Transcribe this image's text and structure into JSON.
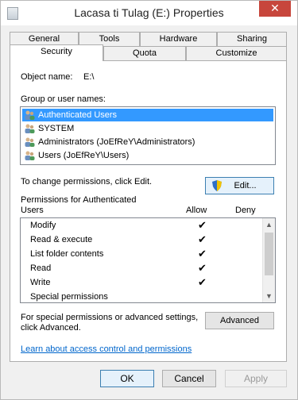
{
  "window": {
    "title": "Lacasa ti Tulag (E:) Properties",
    "close_glyph": "✕"
  },
  "tabs": {
    "row_top": [
      "General",
      "Tools",
      "Hardware",
      "Sharing"
    ],
    "row_bottom": [
      "Security",
      "Quota",
      "Customize"
    ],
    "active": "Security"
  },
  "security": {
    "object_label": "Object name:",
    "object_value": "E:\\",
    "group_label": "Group or user names:",
    "users": [
      {
        "name": "Authenticated Users",
        "selected": true,
        "icon": "users-group-icon"
      },
      {
        "name": "SYSTEM",
        "selected": false,
        "icon": "users-group-icon"
      },
      {
        "name": "Administrators (JoEfReY\\Administrators)",
        "selected": false,
        "icon": "users-group-icon"
      },
      {
        "name": "Users (JoEfReY\\Users)",
        "selected": false,
        "icon": "users-group-icon"
      }
    ],
    "change_text": "To change permissions, click Edit.",
    "edit_label": "Edit...",
    "perm_header_line1": "Permissions for Authenticated",
    "perm_header_line2": "Users",
    "allow_label": "Allow",
    "deny_label": "Deny",
    "permissions": [
      {
        "name": "Modify",
        "allow": true,
        "deny": false
      },
      {
        "name": "Read & execute",
        "allow": true,
        "deny": false
      },
      {
        "name": "List folder contents",
        "allow": true,
        "deny": false
      },
      {
        "name": "Read",
        "allow": true,
        "deny": false
      },
      {
        "name": "Write",
        "allow": true,
        "deny": false
      },
      {
        "name": "Special permissions",
        "allow": false,
        "deny": false
      }
    ],
    "check_glyph": "✔",
    "advanced_text_line1": "For special permissions or advanced settings,",
    "advanced_text_line2": "click Advanced.",
    "advanced_label": "Advanced",
    "learn_link": "Learn about access control and permissions"
  },
  "footer": {
    "ok_label": "OK",
    "cancel_label": "Cancel",
    "apply_label": "Apply"
  },
  "colors": {
    "selection": "#3399ff",
    "close": "#c7463c",
    "link": "#0066cc"
  }
}
